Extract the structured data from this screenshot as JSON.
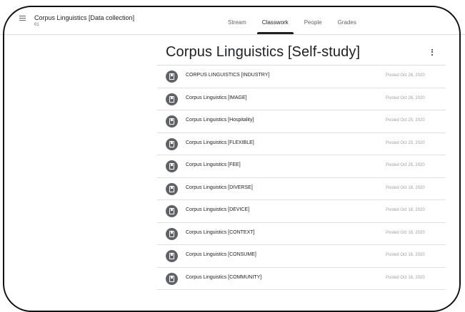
{
  "header": {
    "class_title": "Corpus Linguistics [Data collection]",
    "class_section": "01",
    "tabs": [
      {
        "label": "Stream",
        "active": false
      },
      {
        "label": "Classwork",
        "active": true
      },
      {
        "label": "People",
        "active": false
      },
      {
        "label": "Grades",
        "active": false
      }
    ]
  },
  "main": {
    "title": "Corpus Linguistics [Self-study]",
    "items": [
      {
        "title": "CORPUS LINGUISTICS [INDUSTRY]",
        "posted": "Posted Oct 28, 2020"
      },
      {
        "title": "Corpus Linguistics [IMAGE]",
        "posted": "Posted Oct 28, 2020"
      },
      {
        "title": "Corpus Linguistics [Hospitality]",
        "posted": "Posted Oct 25, 2020"
      },
      {
        "title": "Corpus Linguistics [FLEXIBLE]",
        "posted": "Posted Oct 25, 2020"
      },
      {
        "title": "Corpus Linguistics [FEE]",
        "posted": "Posted Oct 25, 2020"
      },
      {
        "title": "Corpus Linguistics [DIVERSE]",
        "posted": "Posted Oct 18, 2020"
      },
      {
        "title": "Corpus Linguistics [DEVICE]",
        "posted": "Posted Oct 18, 2020"
      },
      {
        "title": "Corpus Linguistics [CONTEXT]",
        "posted": "Posted Oct 18, 2020"
      },
      {
        "title": "Corpus Linguistics [CONSUME]",
        "posted": "Posted Oct 18, 2020"
      },
      {
        "title": "Corpus Linguistics [COMMUNITY]",
        "posted": "Posted Oct 18, 2020"
      }
    ]
  },
  "icons": {
    "menu": "hamburger-menu-icon",
    "more": "more-vert-icon",
    "item": "assignment-icon"
  },
  "colors": {
    "accent": "#202124",
    "icon_bg": "#5f6368",
    "muted": "#9aa0a6"
  }
}
